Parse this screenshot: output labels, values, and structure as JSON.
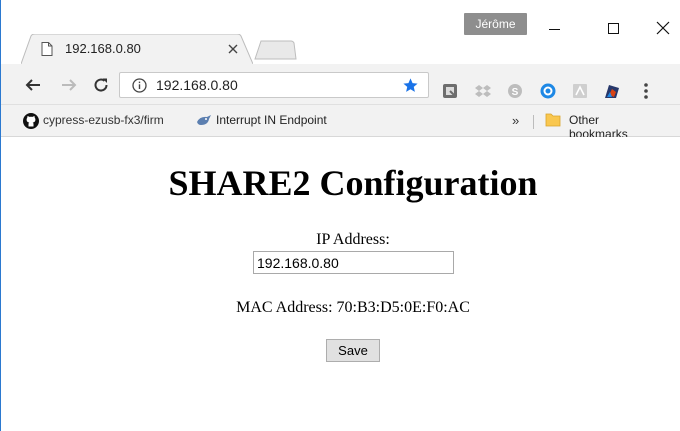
{
  "window": {
    "profile_name": "Jérôme"
  },
  "tab": {
    "title": "192.168.0.80"
  },
  "toolbar": {
    "url": "192.168.0.80"
  },
  "bookmarks": {
    "items": [
      {
        "label": "cypress-ezusb-fx3/firm",
        "icon": "github-icon"
      },
      {
        "label": "Interrupt IN Endpoint",
        "icon": "bookmark-favicon"
      }
    ],
    "overflow": "»",
    "other": "Other bookmarks"
  },
  "page": {
    "title": "SHARE2 Configuration",
    "ip_label": "IP Address:",
    "ip_value": "192.168.0.80",
    "mac_text": "MAC Address: 70:B3:D5:0E:F0:AC",
    "save_label": "Save"
  },
  "colors": {
    "accent": "#2b79d0",
    "star": "#1a73e8"
  }
}
